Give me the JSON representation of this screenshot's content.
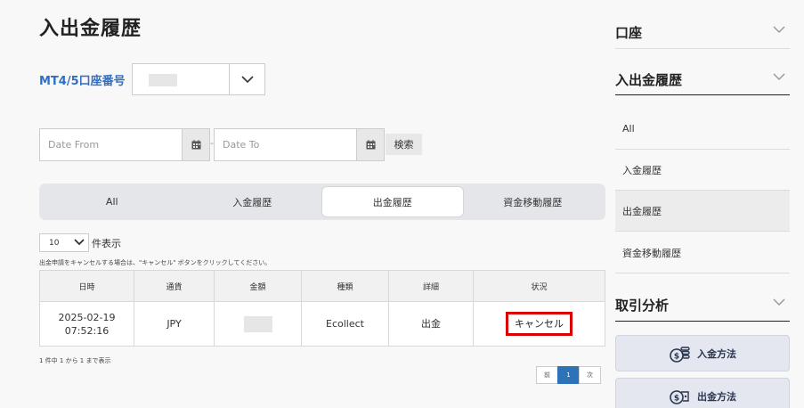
{
  "page_title": "入出金履歴",
  "account": {
    "label": "MT4/5口座番号"
  },
  "filters": {
    "date_from_placeholder": "Date From",
    "date_to_placeholder": "Date To",
    "separator": "-",
    "search_label": "検索"
  },
  "tabs": [
    {
      "label": "All",
      "active": false
    },
    {
      "label": "入金履歴",
      "active": false
    },
    {
      "label": "出金履歴",
      "active": true
    },
    {
      "label": "資金移動履歴",
      "active": false
    }
  ],
  "page_length": {
    "value": "10",
    "suffix": "件表示"
  },
  "cancel_note": "出金申請をキャンセルする場合は、\"キャンセル\" ボタンをクリックしてください。",
  "table": {
    "headers": [
      "日時",
      "通貨",
      "金額",
      "種類",
      "詳細",
      "状況"
    ],
    "rows": [
      {
        "datetime_date": "2025-02-19",
        "datetime_time": "07:52:16",
        "currency": "JPY",
        "type": "Ecollect",
        "detail": "出金",
        "status_button": "キャンセル"
      }
    ]
  },
  "info_text": "1 件中 1 から 1 まで表示",
  "pagination": {
    "prev": "前",
    "current": "1",
    "next": "次"
  },
  "sidebar": {
    "account_heading": "口座",
    "history_heading": "入出金履歴",
    "history_items": [
      {
        "label": "All",
        "active": false
      },
      {
        "label": "入金履歴",
        "active": false
      },
      {
        "label": "出金履歴",
        "active": true
      },
      {
        "label": "資金移動履歴",
        "active": false
      }
    ],
    "analysis_heading": "取引分析",
    "deposit_method": "入金方法",
    "withdraw_method": "出金方法"
  },
  "colors": {
    "accent_blue": "#2f6fc6",
    "cancel_border": "#d90000",
    "pager_active": "#2d73b8"
  }
}
